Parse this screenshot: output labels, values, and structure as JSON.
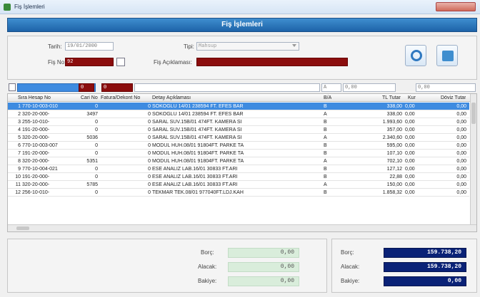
{
  "window": {
    "title": "Fiş İşlemleri"
  },
  "header": {
    "title": "Fiş İşlemleri"
  },
  "form": {
    "tarih_label": "Tarih:",
    "tarih_value": "19/01/2000",
    "tipi_label": "Tipi:",
    "tipi_value": "Mahsup",
    "fisno_label": "Fiş No:",
    "fisno_value": "92",
    "fisaciklamasi_label": "Fiş Açıklaması:"
  },
  "filter": {
    "red_value": "0",
    "red2_value": "0",
    "ba_value": "A",
    "amount1": "0,00",
    "amount2": "0,00"
  },
  "grid": {
    "columns": [
      "Sıra Hesap No",
      "Cari No",
      "Fatura/Dekont No",
      "Detay Açıklaması",
      "B/A",
      "TL Tutar",
      "Kur",
      "Döviz Tutar"
    ],
    "rows": [
      {
        "sira": "1",
        "hesap": "770-10-003-010",
        "cari": "0",
        "fatura": "0",
        "aciklama": "SOKOGLU 14/01 238594 FT. EFES BAR",
        "ba": "B",
        "tutar": "338,00",
        "kur": "0,00",
        "doviz": "0,00"
      },
      {
        "sira": "2",
        "hesap": "320-20-000-",
        "cari": "3497",
        "fatura": "0",
        "aciklama": "SOKOGLU 14/01 238594 FT. EFES BAR",
        "ba": "A",
        "tutar": "338,00",
        "kur": "0,00",
        "doviz": "0,00"
      },
      {
        "sira": "3",
        "hesap": "255-10-010-",
        "cari": "0",
        "fatura": "0",
        "aciklama": "SARAL SUV.15B/01 474FT. KAMERA SI",
        "ba": "B",
        "tutar": "1.993,60",
        "kur": "0,00",
        "doviz": "0,00"
      },
      {
        "sira": "4",
        "hesap": "191-20-000-",
        "cari": "0",
        "fatura": "0",
        "aciklama": "SARAL SUV.15B/01 474FT. KAMERA SI",
        "ba": "B",
        "tutar": "357,00",
        "kur": "0,00",
        "doviz": "0,00"
      },
      {
        "sira": "5",
        "hesap": "320-20-000-",
        "cari": "5036",
        "fatura": "0",
        "aciklama": "SARAL SUV.15B/01 474FT. KAMERA SI",
        "ba": "A",
        "tutar": "2.340,60",
        "kur": "0,00",
        "doviz": "0,00"
      },
      {
        "sira": "6",
        "hesap": "770-10-003-007",
        "cari": "0",
        "fatura": "0",
        "aciklama": "MODUL HUH.08/01 91804FT. PARKE TA",
        "ba": "B",
        "tutar": "595,00",
        "kur": "0,00",
        "doviz": "0,00"
      },
      {
        "sira": "7",
        "hesap": "191-20-000-",
        "cari": "0",
        "fatura": "0",
        "aciklama": "MODUL HUH.08/01 91804FT. PARKE TA",
        "ba": "B",
        "tutar": "107,10",
        "kur": "0,00",
        "doviz": "0,00"
      },
      {
        "sira": "8",
        "hesap": "320-20-000-",
        "cari": "5351",
        "fatura": "0",
        "aciklama": "MODUL HUH.08/01 91804FT. PARKE TA",
        "ba": "A",
        "tutar": "702,10",
        "kur": "0,00",
        "doviz": "0,00"
      },
      {
        "sira": "9",
        "hesap": "770-10-004-021",
        "cari": "0",
        "fatura": "0",
        "aciklama": "ESE ANALIZ LAB.16/01 30833 FT.ARI",
        "ba": "B",
        "tutar": "127,12",
        "kur": "0,00",
        "doviz": "0,00"
      },
      {
        "sira": "10",
        "hesap": "191-20-000-",
        "cari": "0",
        "fatura": "0",
        "aciklama": "ESE ANALIZ LAB.16/01 30833 FT.ARI",
        "ba": "B",
        "tutar": "22,88",
        "kur": "0,00",
        "doviz": "0,00"
      },
      {
        "sira": "11",
        "hesap": "320-20-000-",
        "cari": "5785",
        "fatura": "0",
        "aciklama": "ESE ANALIZ LAB.16/01 30833 FT.ARI",
        "ba": "A",
        "tutar": "150,00",
        "kur": "0,00",
        "doviz": "0,00"
      },
      {
        "sira": "12",
        "hesap": "256-10-010-",
        "cari": "0",
        "fatura": "0",
        "aciklama": "TEKMAR TEK.08/01 977040FT.LDJ.KAH",
        "ba": "B",
        "tutar": "1.858,32",
        "kur": "0,00",
        "doviz": "0,00"
      }
    ]
  },
  "totals_left": {
    "borc_label": "Borç:",
    "borc": "0,00",
    "alacak_label": "Alacak:",
    "alacak": "0,00",
    "bakiye_label": "Bakiye:",
    "bakiye": "0,00"
  },
  "totals_right": {
    "borc_label": "Borç:",
    "borc": "159.738,20",
    "alacak_label": "Alacak:",
    "alacak": "159.738,20",
    "bakiye_label": "Bakiye:",
    "bakiye": "0,00"
  },
  "colors": {
    "header_blue": "#1d63a8",
    "selected_row": "#3e8be0",
    "red_input": "#8b0d0d",
    "navy_total": "#0a2277",
    "green_total": "#d9eddb"
  },
  "icons": [
    "app-icon",
    "search-icon",
    "print-icon",
    "lookup-icon",
    "edit-icon",
    "dropdown-icon"
  ]
}
